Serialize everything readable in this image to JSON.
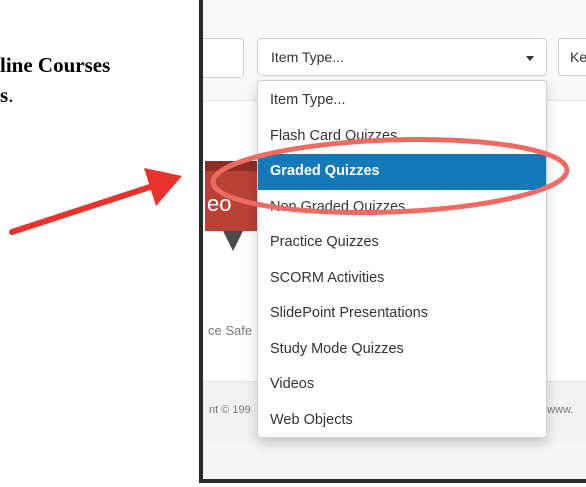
{
  "doc": {
    "line1": "line Courses",
    "line2": "s",
    "line2_period": "."
  },
  "toolbar": {
    "select_label": "Item Type...",
    "right_button_label": "Ke"
  },
  "dropdown": {
    "items": [
      {
        "label": "Item Type..."
      },
      {
        "label": "Flash Card Quizzes"
      },
      {
        "label": "Graded Quizzes",
        "selected": true
      },
      {
        "label": "Non Graded Quizzes"
      },
      {
        "label": "Practice Quizzes"
      },
      {
        "label": "SCORM Activities"
      },
      {
        "label": "SlidePoint Presentations"
      },
      {
        "label": "Study Mode Quizzes"
      },
      {
        "label": "Videos"
      },
      {
        "label": "Web Objects"
      }
    ]
  },
  "content": {
    "thumb_label": "eo",
    "course_snippet": "ce Safe",
    "copyright_snippet": "nt © 199",
    "url_snippet": "//www."
  },
  "colors": {
    "arrow": "#e8322c",
    "highlight_ellipse": "#ef6a62",
    "selected_item": "#1479b8",
    "thumbnail": "#b84236"
  },
  "icons": {
    "select_caret": "chevron-down-icon",
    "pointer_arrow": "arrow-icon"
  }
}
